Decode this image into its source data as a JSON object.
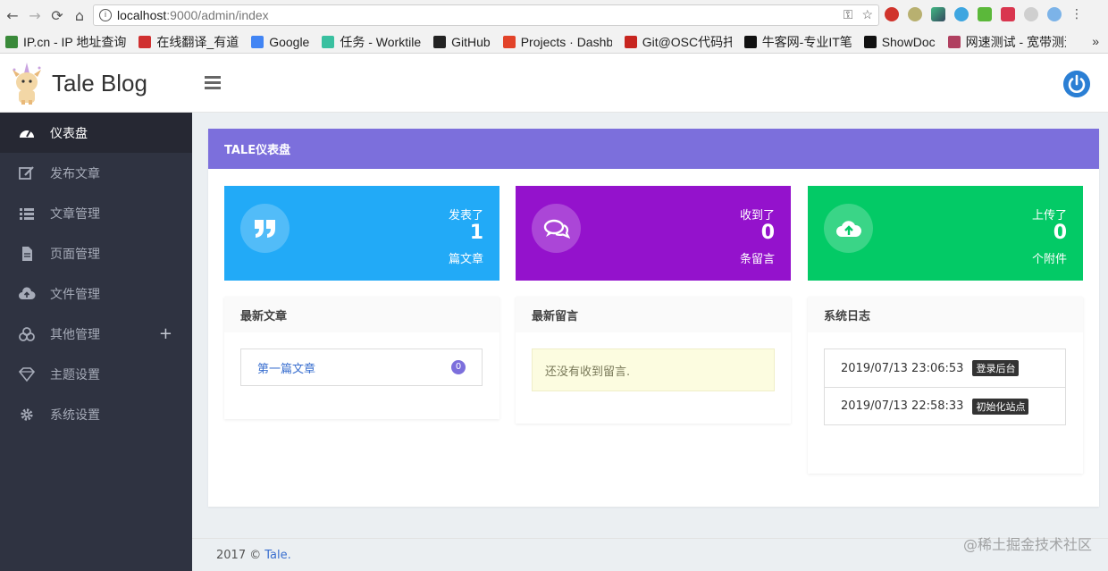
{
  "browser": {
    "url_host": "localhost",
    "url_path": ":9000/admin/index",
    "bookmarks": [
      {
        "label": "IP.cn - IP 地址查询",
        "color": "#3a8a3a"
      },
      {
        "label": "在线翻译_有道",
        "color": "#d03030"
      },
      {
        "label": "Google",
        "color": "#4285f4"
      },
      {
        "label": "任务 - Worktile",
        "color": "#39c0a0"
      },
      {
        "label": "GitHub",
        "color": "#222222"
      },
      {
        "label": "Projects · Dashboard",
        "color": "#e24329"
      },
      {
        "label": "Git@OSC代码托管",
        "color": "#c7251f"
      },
      {
        "label": "牛客网-专业IT笔试",
        "color": "#111111"
      },
      {
        "label": "ShowDoc",
        "color": "#111111"
      },
      {
        "label": "网速测试 - 宽带测速",
        "color": "#b04060"
      }
    ],
    "more": "»"
  },
  "app": {
    "logo_text": "Tale Blog"
  },
  "sidebar": {
    "items": [
      {
        "label": "仪表盘",
        "icon": "dashboard-icon",
        "active": true
      },
      {
        "label": "发布文章",
        "icon": "edit-icon"
      },
      {
        "label": "文章管理",
        "icon": "list-icon"
      },
      {
        "label": "页面管理",
        "icon": "file-icon"
      },
      {
        "label": "文件管理",
        "icon": "cloud-upload-icon"
      },
      {
        "label": "其他管理",
        "icon": "cubes-icon",
        "expand": "+"
      },
      {
        "label": "主题设置",
        "icon": "diamond-icon"
      },
      {
        "label": "系统设置",
        "icon": "gear-icon"
      }
    ]
  },
  "dashboard": {
    "title": "TALE仪表盘",
    "colors": {
      "header": "#7c6fdc",
      "articles": "#22aaf7",
      "comments": "#9412cc",
      "attachments": "#03ca66"
    },
    "stats": [
      {
        "label": "发表了",
        "value": "1",
        "unit": "篇文章",
        "icon": "quote-icon"
      },
      {
        "label": "收到了",
        "value": "0",
        "unit": "条留言",
        "icon": "comments-icon"
      },
      {
        "label": "上传了",
        "value": "0",
        "unit": "个附件",
        "icon": "cloud-upload-icon"
      }
    ],
    "latest_articles": {
      "title": "最新文章",
      "items": [
        {
          "title": "第一篇文章",
          "count": "0"
        }
      ]
    },
    "latest_comments": {
      "title": "最新留言",
      "empty": "还没有收到留言."
    },
    "system_logs": {
      "title": "系统日志",
      "items": [
        {
          "time": "2019/07/13 23:06:53",
          "action": "登录后台"
        },
        {
          "time": "2019/07/13 22:58:33",
          "action": "初始化站点"
        }
      ]
    }
  },
  "footer": {
    "text": "2017 ©",
    "link": "Tale."
  },
  "watermark": "@稀土掘金技术社区"
}
